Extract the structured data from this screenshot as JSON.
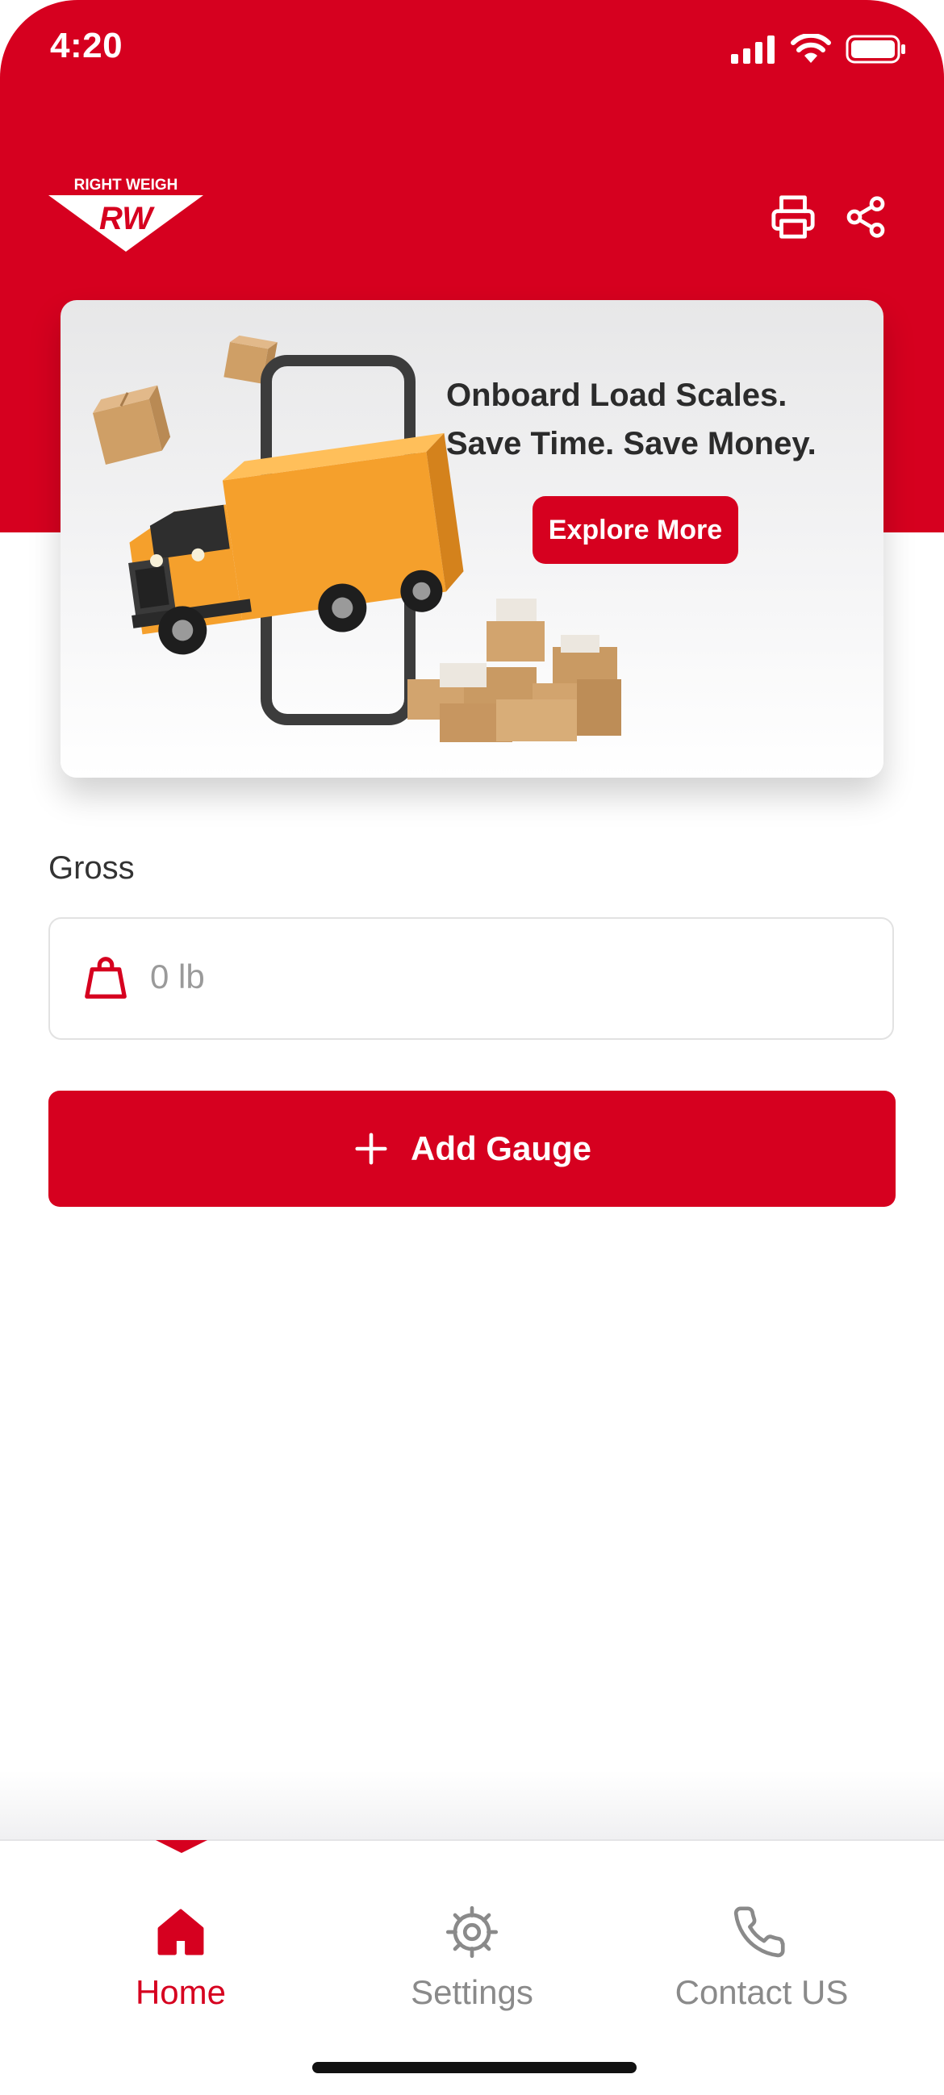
{
  "status_bar": {
    "time": "4:20"
  },
  "header": {
    "logo_text": "RIGHT WEIGH",
    "logo_mark": "RW",
    "print_icon": "printer-icon",
    "share_icon": "share-icon"
  },
  "banner": {
    "headline_line1": "Onboard Load Scales.",
    "headline_line2": "Save Time. Save Money.",
    "button_label": "Explore More"
  },
  "gross": {
    "label": "Gross",
    "value": "0 lb",
    "icon": "weight-icon"
  },
  "add_gauge": {
    "label": "Add Gauge",
    "icon": "plus-icon"
  },
  "nav": {
    "items": [
      {
        "label": "Home",
        "icon": "home-icon",
        "active": true
      },
      {
        "label": "Settings",
        "icon": "gear-icon",
        "active": false
      },
      {
        "label": "Contact US",
        "icon": "phone-icon",
        "active": false
      }
    ]
  },
  "colors": {
    "brand_red": "#d6001f",
    "inactive_gray": "#8a8a8a",
    "text_dark": "#2b2b2b"
  }
}
